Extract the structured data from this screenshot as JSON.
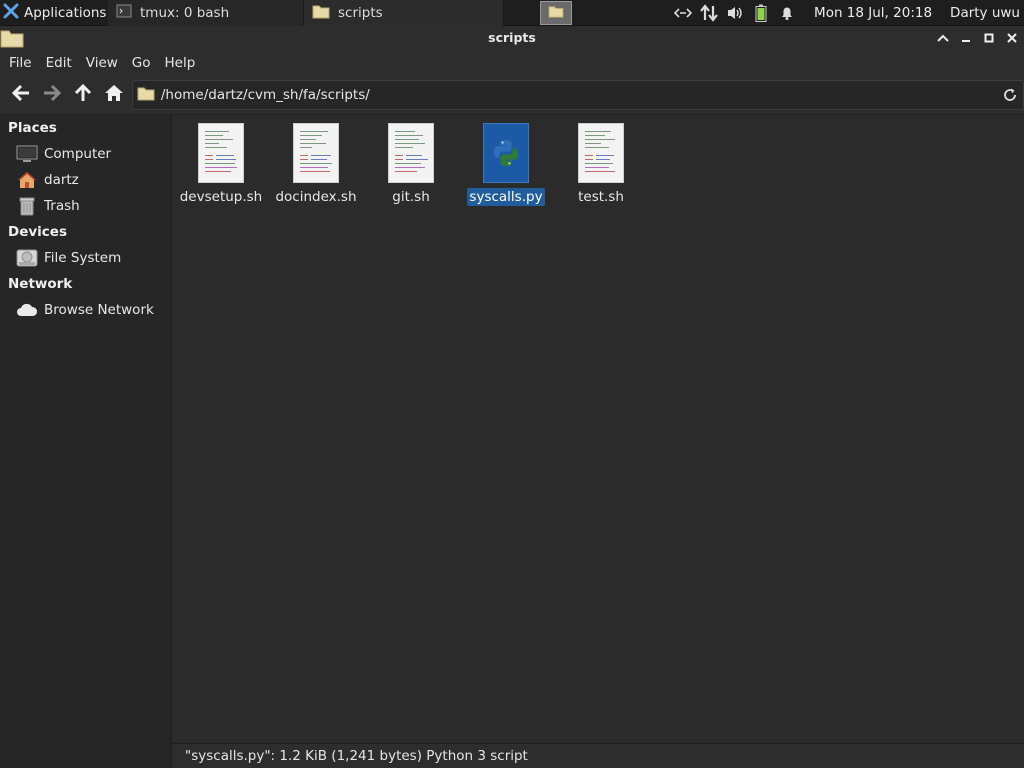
{
  "panel": {
    "applications_label": "Applications",
    "tasks": [
      {
        "label": "tmux: 0 bash",
        "icon": "terminal-icon"
      },
      {
        "label": "scripts",
        "icon": "folder-icon"
      }
    ],
    "clock": "Mon 18 Jul, 20:18",
    "user": "Darty uwu"
  },
  "window": {
    "title": "scripts"
  },
  "menubar": [
    "File",
    "Edit",
    "View",
    "Go",
    "Help"
  ],
  "toolbar": {
    "path": "/home/dartz/cvm_sh/fa/scripts/"
  },
  "sidebar": {
    "places_header": "Places",
    "places": [
      {
        "label": "Computer",
        "icon": "computer-icon"
      },
      {
        "label": "dartz",
        "icon": "home-icon"
      },
      {
        "label": "Trash",
        "icon": "trash-icon"
      }
    ],
    "devices_header": "Devices",
    "devices": [
      {
        "label": "File System",
        "icon": "drive-icon"
      }
    ],
    "network_header": "Network",
    "network": [
      {
        "label": "Browse Network",
        "icon": "cloud-icon"
      }
    ]
  },
  "files": [
    {
      "name": "devsetup.sh",
      "type": "shell-script"
    },
    {
      "name": "docindex.sh",
      "type": "shell-script"
    },
    {
      "name": "git.sh",
      "type": "shell-script"
    },
    {
      "name": "syscalls.py",
      "type": "python-script",
      "selected": true
    },
    {
      "name": "test.sh",
      "type": "shell-script"
    }
  ],
  "status": "\"syscalls.py\": 1.2 KiB (1,241 bytes) Python 3 script",
  "colors": {
    "selection": "#215d9c",
    "python_icon_bg": "#1c5aa6",
    "battery": "#8fd14f"
  }
}
